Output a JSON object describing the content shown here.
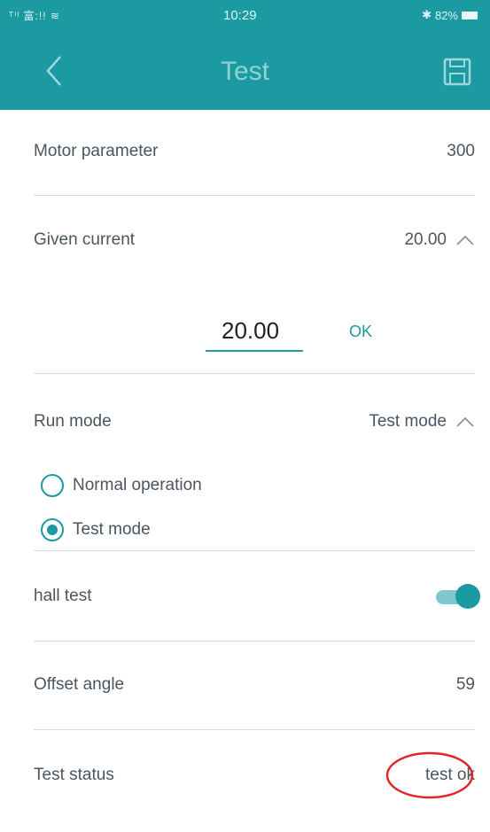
{
  "status_bar": {
    "left": "ᵀⁱˡ 富:!! ≋",
    "time": "10:29",
    "bluetooth": "✱",
    "battery_text": "82%"
  },
  "app_bar": {
    "title": "Test",
    "back_icon": "chevron-left-icon",
    "save_icon": "save-icon"
  },
  "motor_parameter": {
    "label": "Motor parameter",
    "value": "300"
  },
  "given_current": {
    "label": "Given current",
    "value": "20.00",
    "input_value": "20.00",
    "ok_label": "OK"
  },
  "run_mode": {
    "label": "Run mode",
    "value": "Test mode",
    "options": [
      {
        "label": "Normal operation",
        "selected": false
      },
      {
        "label": "Test mode",
        "selected": true
      }
    ]
  },
  "hall_test": {
    "label": "hall test",
    "enabled": true
  },
  "offset_angle": {
    "label": "Offset angle",
    "value": "59"
  },
  "test_status": {
    "label": "Test status",
    "value": "test ok"
  },
  "colors": {
    "primary": "#1b9aa2",
    "annotation": "#e0262b"
  }
}
